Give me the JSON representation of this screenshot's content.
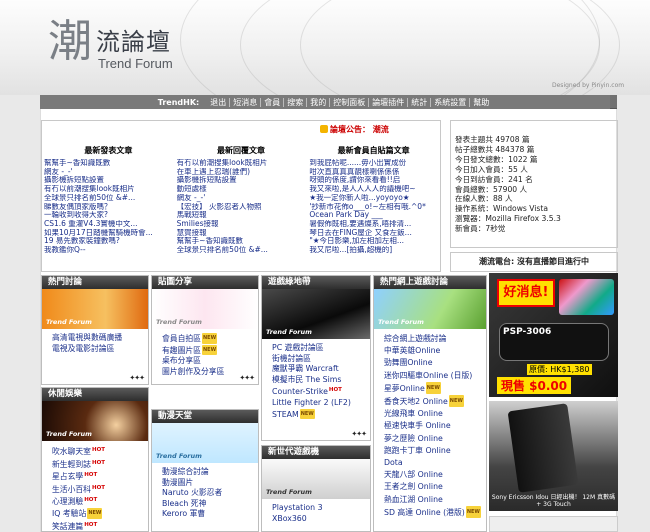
{
  "header": {
    "logo_char": "潮",
    "logo_title": "流論壇",
    "logo_subtitle": "Trend Forum",
    "designed_by": "Designed by Pinyin.com"
  },
  "nav": {
    "brand": "TrendHK:",
    "items": [
      "退出",
      "短消息",
      "會員",
      "搜索",
      "我的",
      "控制面板",
      "論壇插件",
      "統計",
      "系統設置",
      "幫助"
    ]
  },
  "latest": {
    "announce": "論壇公告： 潮流",
    "columns": [
      {
        "title": "最新發表文章",
        "items": [
          "幫幫手~香知識既數",
          "網友 -_-'",
          "攝影機拆短點設置",
          "有冇以前潮搜集look既相片",
          "全球景只排名前50位 &#...",
          "睇數友偶頂家版嗎？",
          "一輪收到收得大家?",
          "CS1.6 重灌V4.3實機中文...",
          "如果10月17日踏機幫騎機時會...",
          "19 易先數家裝鐘數嗎?",
          "我教鑑你Q--"
        ]
      },
      {
        "title": "最新回覆文章",
        "items": [
          "有冇以前潮搜集look既相片",
          "在車上遇上忍瑞(誰們)",
          "攝影機拆短點設置",
          "動短處樣",
          "網友 -_-'",
          "【宏技】 火影忍者人物照",
          "馬戰短報",
          "Smilies接報",
          "慧賀接報",
          "幫幫手~香知識既數",
          "全球景只排名前50位 &#..."
        ]
      },
      {
        "title": "最新會員自貼篇文章",
        "items": [
          "到我屁帖呢......毋小出實成份",
          "咁次直真真真靚樣喇係係係",
          "呀頭的係度,謂你來看看!!启",
          "我又來啦,是人人人人的議機吧~",
          "★我一定你新人啦...yoyoyo★",
          "'抄新市花佈o___o!~左相有哦.^0*",
          "Ocean Park Day ___",
          "暑假佈既相,要遇燦系,唔排清...",
          "琴日去在FING屋企 又食左飯...",
          "\"★今日影樂,加左相加左相...",
          "我又尼啦...[拍攝,超機的]"
        ]
      }
    ]
  },
  "stats": {
    "lines": [
      "發表主題共 49708 篇",
      "帖子總數共 484378 篇",
      "今日發文總數：1022 篇",
      "今日加入會員：55 人",
      "今日到訪會員：241 名",
      "會員總數：57900 人",
      "在線人數：88 人",
      "操作系統：Windows Vista",
      "瀏覽器：Mozilla Firefox 3.5.3",
      "新會員：7秒觉"
    ]
  },
  "tv": "潮流電台: 沒有直播節目進行中",
  "panels": {
    "hot": {
      "title": "熱門討論",
      "banner": "Trend Forum",
      "items": [
        {
          "t": "高清電視與數碼廣播",
          "b": ""
        },
        {
          "t": "電視及電影討論區",
          "b": ""
        }
      ]
    },
    "leisure": {
      "title": "休閒娛樂",
      "banner": "Trend Forum",
      "items": [
        {
          "t": "吹水聊天室",
          "b": "HOT"
        },
        {
          "t": "新生輕到誌",
          "b": "HOT"
        },
        {
          "t": "星占玄學",
          "b": "HOT"
        },
        {
          "t": "生活小百科",
          "b": "HOT"
        },
        {
          "t": "心理測驗",
          "b": "HOT"
        },
        {
          "t": "IQ 考驗站",
          "b": "NEW"
        },
        {
          "t": "笑話連篇",
          "b": "HOT"
        }
      ]
    },
    "share": {
      "title": "貼圖分享",
      "banner": "Trend Forum",
      "items": [
        {
          "t": "會員自拍區",
          "b": "NEW"
        },
        {
          "t": "有趣圖片區",
          "b": "NEW"
        },
        {
          "t": "桌布分享區",
          "b": ""
        },
        {
          "t": "圖片創作及分享區",
          "b": ""
        }
      ]
    },
    "anime": {
      "title": "動漫天堂",
      "banner": "Trend Forum",
      "items": [
        {
          "t": "動漫綜合討論",
          "b": ""
        },
        {
          "t": "動漫圖片",
          "b": ""
        },
        {
          "t": "Naruto 火影忍者",
          "b": ""
        },
        {
          "t": "Bleach 死神",
          "b": ""
        },
        {
          "t": "Keroro 軍曹",
          "b": ""
        }
      ]
    },
    "games": {
      "title": "遊戲綠地帶",
      "banner": "Trend Forum",
      "items": [
        {
          "t": "PC 遊戲討論區",
          "b": ""
        },
        {
          "t": "街機討論區",
          "b": ""
        },
        {
          "t": "魔獸爭霸 Warcraft",
          "b": ""
        },
        {
          "t": "模擬市民 The Sims",
          "b": ""
        },
        {
          "t": "Counter-Strike",
          "b": "HOT"
        },
        {
          "t": "Little Fighter 2 (LF2)",
          "b": ""
        },
        {
          "t": "STEAM",
          "b": "NEW"
        }
      ]
    },
    "nextgen": {
      "title": "新世代遊戲機",
      "banner": "Trend Forum",
      "items": [
        {
          "t": "Playstation 3",
          "b": ""
        },
        {
          "t": "XBox360",
          "b": ""
        }
      ]
    },
    "online": {
      "title": "熱門網上遊戲討論",
      "banner": "Trend Forum",
      "items": [
        {
          "t": "綜合網上遊戲討論",
          "b": ""
        },
        {
          "t": "中華英雄Online",
          "b": ""
        },
        {
          "t": "勁舞團Online",
          "b": ""
        },
        {
          "t": "迷你四驅車Online (日版)",
          "b": ""
        },
        {
          "t": "星夢Online",
          "b": "NEW"
        },
        {
          "t": "香食天地2 Online",
          "b": "NEW"
        },
        {
          "t": "光線飛車 Online",
          "b": ""
        },
        {
          "t": "極速快車手 Online",
          "b": ""
        },
        {
          "t": "夢之歷險 Online",
          "b": ""
        },
        {
          "t": "跑跑卡丁車 Online",
          "b": ""
        },
        {
          "t": "Dota",
          "b": ""
        },
        {
          "t": "天龍八部 Online",
          "b": ""
        },
        {
          "t": "王者之劍 Online",
          "b": ""
        },
        {
          "t": "熱血江湖 Online",
          "b": ""
        },
        {
          "t": "SD 高達 Online (港版)",
          "b": "NEW"
        }
      ]
    }
  },
  "ads": {
    "psp_tag": "好消息!",
    "psp_model": "PSP-3006",
    "psp_price": "原價: HK$1,380",
    "psp_now": "現售 $0.00",
    "phone_caption": "Sony Ericsson Idou 日經出機！ 12M 真數碼 + 3G Touch"
  }
}
